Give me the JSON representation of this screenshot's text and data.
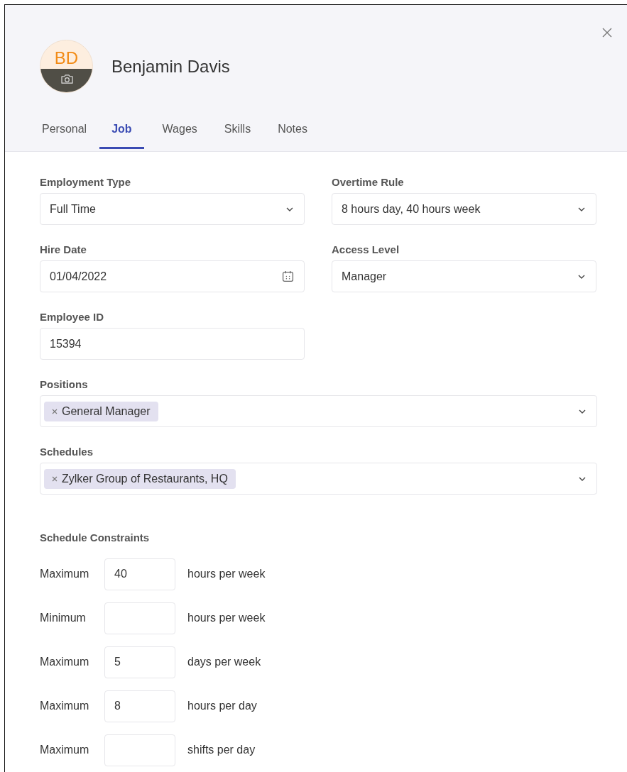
{
  "header": {
    "initials": "BD",
    "name": "Benjamin Davis"
  },
  "tabs": [
    {
      "label": "Personal",
      "selected": false
    },
    {
      "label": "Job",
      "selected": true
    },
    {
      "label": "Wages",
      "selected": false
    },
    {
      "label": "Skills",
      "selected": false
    },
    {
      "label": "Notes",
      "selected": false
    }
  ],
  "fields": [
    {
      "label": "Employment Type",
      "kind": "select",
      "value": "Full Time"
    },
    {
      "label": "Overtime Rule",
      "kind": "select",
      "value": "8 hours day, 40 hours week"
    },
    {
      "label": "Hire Date",
      "kind": "date",
      "value": "01/04/2022"
    },
    {
      "label": "Access Level",
      "kind": "select",
      "value": "Manager"
    },
    {
      "label": "Employee ID",
      "kind": "text",
      "value": "15394"
    }
  ],
  "multi_fields": [
    {
      "label": "Positions",
      "tags": [
        "General Manager"
      ]
    },
    {
      "label": "Schedules",
      "tags": [
        "Zylker Group of Restaurants, HQ"
      ]
    }
  ],
  "constraints": {
    "title": "Schedule Constraints",
    "rows": [
      {
        "bound": "Maximum",
        "value": "40",
        "unit": "hours per week"
      },
      {
        "bound": "Minimum",
        "unit": "hours per week"
      },
      {
        "bound": "Maximum",
        "value": "5",
        "unit": "days per week"
      },
      {
        "bound": "Maximum",
        "value": "8",
        "unit": "hours per day"
      },
      {
        "bound": "Maximum",
        "unit": "shifts per day"
      }
    ]
  }
}
